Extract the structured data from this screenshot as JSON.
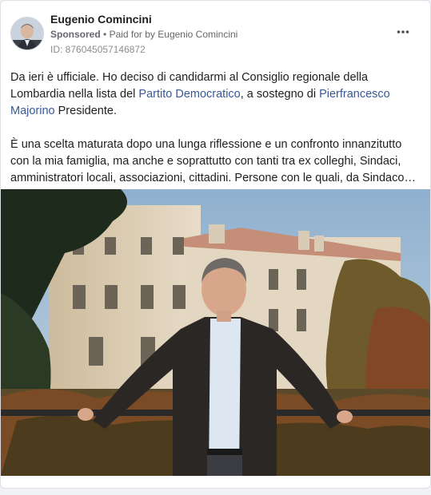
{
  "post": {
    "author_name": "Eugenio Comincini",
    "sponsored_label": "Sponsored",
    "separator": "•",
    "paid_for_prefix": "Paid for by",
    "paid_for_name": "Eugenio Comincini",
    "id_text": "ID: 876045057146872",
    "more_icon": "more-horizontal-icon"
  },
  "text": {
    "p1_a": "Da ieri è ufficiale. Ho deciso di candidarmi al Consiglio regionale della Lombardia nella lista del ",
    "p1_link1": "Partito Democratico",
    "p1_b": ", a sostegno di ",
    "p1_link2": "Pierfrancesco Majorino",
    "p1_c": " Presidente.",
    "p2": "È una scelta maturata dopo una lunga riflessione e un confronto innanzitutto con la mia famiglia, ma anche e soprattutto con tanti tra ex colleghi, Sindaci, amministratori locali, associazioni, cittadini. Persone con le quali, da Sindaco…"
  },
  "colors": {
    "link": "#385898",
    "secondary_text": "#65676b"
  }
}
